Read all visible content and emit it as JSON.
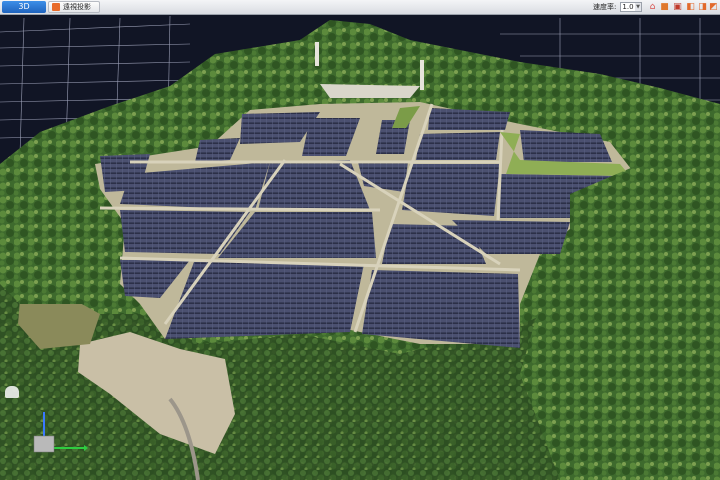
{
  "toolbar": {
    "tab_3d_label": "3D",
    "tab_ortho_label": "遠視投影",
    "speed_label": "速度率:",
    "speed_value": "1.0"
  },
  "icons": {
    "home": "home-icon",
    "cube_a": "cube-icon",
    "cube_b": "box-icon",
    "view_a": "view-front-icon",
    "view_b": "view-side-icon",
    "view_c": "view-top-icon"
  },
  "colors": {
    "toolbar_active": "#1f63bd",
    "background": "#101422",
    "grid": "#c9cde6",
    "solar_panel": "#4a4f6e",
    "vegetation": "#3d6a2c"
  }
}
